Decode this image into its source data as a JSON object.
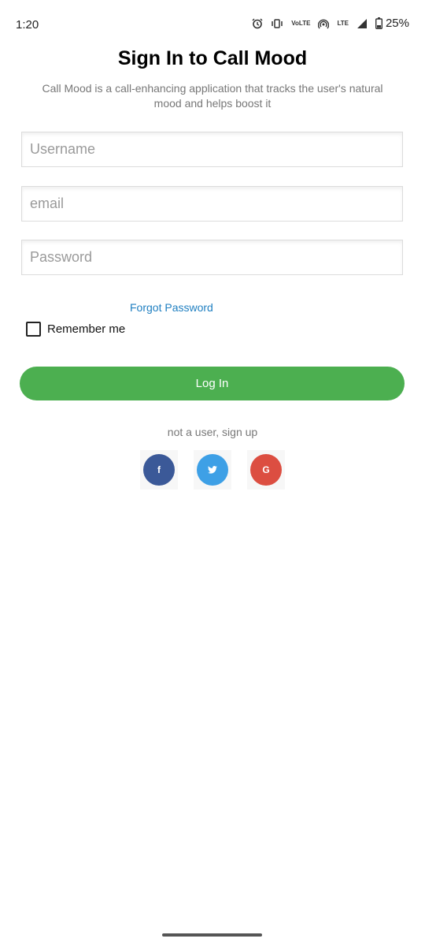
{
  "status_bar": {
    "time": "1:20",
    "volte_label": "VoLTE",
    "lte_label": "LTE",
    "battery": "25%"
  },
  "header": {
    "title": "Sign In to Call Mood",
    "subtitle": "Call Mood is a call-enhancing application that tracks the user's natural mood and helps boost it"
  },
  "form": {
    "username_placeholder": "Username",
    "email_placeholder": "email",
    "password_placeholder": "Password",
    "forgot_password": "Forgot Password",
    "remember_me": "Remember me",
    "login_label": "Log In"
  },
  "signup_text": "not a user, sign up",
  "social": [
    {
      "name": "facebook",
      "glyph": "f",
      "color": "#3b5998"
    },
    {
      "name": "twitter",
      "glyph": "t",
      "color": "#3ea0e6"
    },
    {
      "name": "google",
      "glyph": "G",
      "color": "#dc4e41"
    }
  ],
  "colors": {
    "primary_button": "#4caf50",
    "link": "#1f7fc1"
  }
}
